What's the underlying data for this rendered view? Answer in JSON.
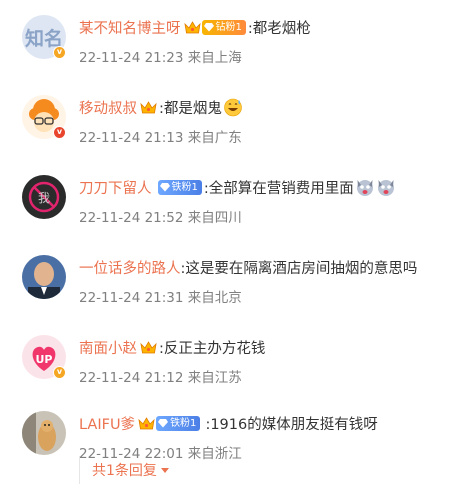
{
  "comments": [
    {
      "name": "某不知名博主呀",
      "fan_badge": "钻粉1",
      "text": ":都老烟枪",
      "meta": "22-11-24 21:23 来自上海",
      "avatar_text": "知名"
    },
    {
      "name": "移动叔叔",
      "fan_badge": "",
      "text": ":都是烟鬼",
      "meta": "22-11-24 21:13 来自广东",
      "emoji": "grinning-sweat-emoji"
    },
    {
      "name": "刀刀下留人",
      "fan_badge": "铁粉1",
      "text": ":全部算在营销费用里面",
      "meta": "22-11-24 21:52 来自四川",
      "avatar_text": "我"
    },
    {
      "name": "一位话多的路人",
      "fan_badge": "",
      "text": ":这是要在隔离酒店房间抽烟的意思吗",
      "meta": "22-11-24 21:31 来自北京"
    },
    {
      "name": "南面小赵",
      "fan_badge": "",
      "text": ":反正主办方花钱",
      "meta": "22-11-24 21:12 来自江苏",
      "avatar_text": "UP"
    },
    {
      "name": "LAIFU爹",
      "fan_badge": "铁粉1",
      "text": ":1916的媒体朋友挺有钱呀",
      "meta": "22-11-24 22:01 来自浙江"
    }
  ],
  "reply_summary": "共1条回复",
  "colors": {
    "username": "#eb7350",
    "meta": "#808080",
    "text": "#333333"
  }
}
